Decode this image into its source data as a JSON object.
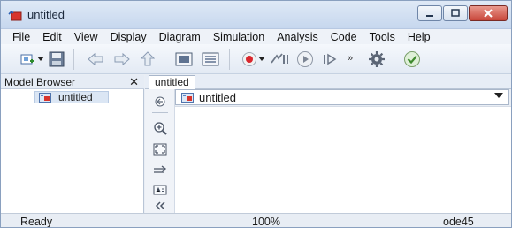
{
  "window": {
    "title": "untitled",
    "controls": [
      "minimize-icon",
      "maximize-icon",
      "close-icon"
    ]
  },
  "menu": {
    "items": [
      "File",
      "Edit",
      "View",
      "Display",
      "Diagram",
      "Simulation",
      "Analysis",
      "Code",
      "Tools",
      "Help"
    ]
  },
  "toolbar": {
    "more_label": "»",
    "icons": [
      "new-model-icon",
      "dropdown-arrow-icon",
      "save-icon",
      "back-icon",
      "forward-icon",
      "up-icon",
      "library-browser-icon",
      "model-explorer-icon",
      "record-icon",
      "record-dropdown-icon",
      "step-back-icon",
      "run-icon",
      "step-forward-icon",
      "settings-icon",
      "check-icon"
    ]
  },
  "model_browser": {
    "title": "Model Browser",
    "close_label": "✕",
    "tree": [
      {
        "label": "untitled"
      }
    ]
  },
  "editor": {
    "tab": "untitled",
    "address": "untitled",
    "palette": [
      "hide-browser-icon",
      "zoom-icon",
      "fit-view-icon",
      "arrow-icon",
      "annotation-icon",
      "collapse-icon"
    ]
  },
  "status": {
    "state": "Ready",
    "zoom": "100%",
    "solver": "ode45"
  },
  "colors": {
    "title_bg": "#c6d7ee",
    "close_button": "#c8463a",
    "selection": "#dbe6f4"
  }
}
